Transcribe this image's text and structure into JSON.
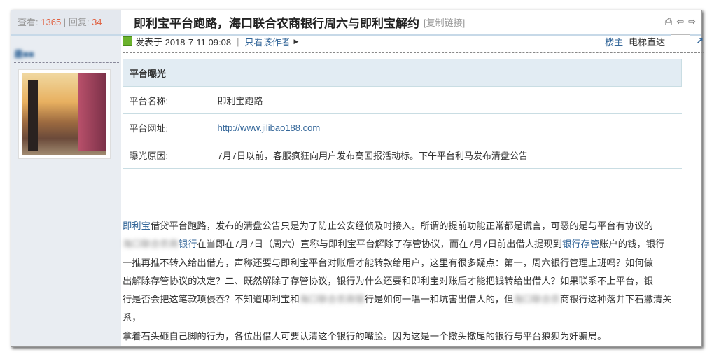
{
  "stats": {
    "views_label": "查看:",
    "views": "1365",
    "sep": "|",
    "replies_label": "回复:",
    "replies": "34"
  },
  "author": "最■■",
  "thread": {
    "title": "即利宝平台跑路，海口联合农商银行周六与即利宝解约",
    "copy_link": "[复制链接]"
  },
  "toolbar": {
    "print": "⎙",
    "prev": "⇦",
    "next": "⇨"
  },
  "post": {
    "posted": "发表于 2018-7-11 09:08",
    "sep": "|",
    "only_author": "只看该作者",
    "floor": "楼主",
    "elevator": "电梯直达",
    "go": "↗"
  },
  "table": {
    "header": "平台曝光",
    "rows": [
      {
        "k": "平台名称:",
        "v": "即利宝跑路"
      },
      {
        "k": "平台网址:",
        "v": "http://www.jilibao188.com"
      },
      {
        "k": "曝光原因:",
        "v": "7月7日以前，客服疯狂向用户发布高回报活动标。下午平台利马发布清盘公告"
      }
    ]
  },
  "body": {
    "l1a": "即利宝",
    "l1b": "借贷平台跑路，发布的清盘公告只是为了防止公安经侦及时接入。所谓的提前功能正常都是谎言，可恶的是与平台有协议的",
    "l2blur": "海口联合农商",
    "l2a": "银行",
    "l2b": "在当即在7月7日（周六）宣称与即利宝平台解除了存管协议，而在7月7日前出借人提现到",
    "l2c": "银行存管",
    "l2d": "账户的钱，银行",
    "l3": "一推再推不转入给出借方，声称还要与即利宝平台对账后才能转款给用户，这里有很多疑点：第一，周六银行管理上班吗？如何做",
    "l4": "出解除存管协议的决定？二、既然解除了存管协议，银行为什么还要和即利宝对账后才能把钱转给出借人？如果联系不上平台，银",
    "l5a": "行是否会把这笔款项侵吞？不知道即利宝和",
    "l5blur1": "海口联合农商银",
    "l5b": "行是如何一唱一和坑害出借人的，但",
    "l5blur2": "海口联合农",
    "l5c": "商银行这种落井下石撇清关系，",
    "l6": "拿着石头砸自己脚的行为，各位出借人可要认清这个银行的嘴脸。因为这是一个撤头撤尾的银行与平台狼狈为奸骗局。"
  }
}
